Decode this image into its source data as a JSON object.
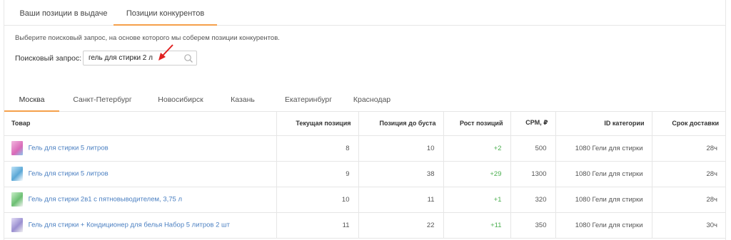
{
  "top_tabs": [
    {
      "label": "Ваши позиции в выдаче",
      "active": false
    },
    {
      "label": "Позиции конкурентов",
      "active": true
    }
  ],
  "hint": "Выберите поисковый запрос, на основе которого мы соберем позиции конкурентов.",
  "search": {
    "label": "Поисковый запрос:",
    "value": "гель для стирки 2 л"
  },
  "city_tabs": [
    {
      "label": "Москва",
      "active": true
    },
    {
      "label": "Санкт-Петербург",
      "active": false
    },
    {
      "label": "Новосибирск",
      "active": false
    },
    {
      "label": "Казань",
      "active": false
    },
    {
      "label": "Екатеринбург",
      "active": false
    },
    {
      "label": "Краснодар",
      "active": false
    }
  ],
  "table": {
    "headers": [
      "Товар",
      "Текущая позиция",
      "Позиция до буста",
      "Рост позиций",
      "CPM, ₽",
      "ID категории",
      "Срок доставки"
    ],
    "rows": [
      {
        "product": "Гель для стирки 5 литров",
        "current": "8",
        "before": "10",
        "growth": "+2",
        "cpm": "500",
        "category": "1080 Гели для стирки",
        "delivery": "28ч",
        "thumb_color": "#d96ab8"
      },
      {
        "product": "Гель для стирки 5 литров",
        "current": "9",
        "before": "38",
        "growth": "+29",
        "cpm": "1300",
        "category": "1080 Гели для стирки",
        "delivery": "28ч",
        "thumb_color": "#5aa7d6"
      },
      {
        "product": "Гель для стирки 2в1 с пятновыводителем, 3,75 л",
        "current": "10",
        "before": "11",
        "growth": "+1",
        "cpm": "320",
        "category": "1080 Гели для стирки",
        "delivery": "28ч",
        "thumb_color": "#6cbf73"
      },
      {
        "product": "Гель для стирки + Кондиционер для белья Набор 5 литров 2 шт",
        "current": "11",
        "before": "22",
        "growth": "+11",
        "cpm": "350",
        "category": "1080 Гели для стирки",
        "delivery": "30ч",
        "thumb_color": "#9a8fd1"
      }
    ]
  },
  "colors": {
    "accent": "#f5a04a",
    "link": "#4a7fc1",
    "growth": "#4caf50",
    "annotation_arrow": "#e02020"
  }
}
